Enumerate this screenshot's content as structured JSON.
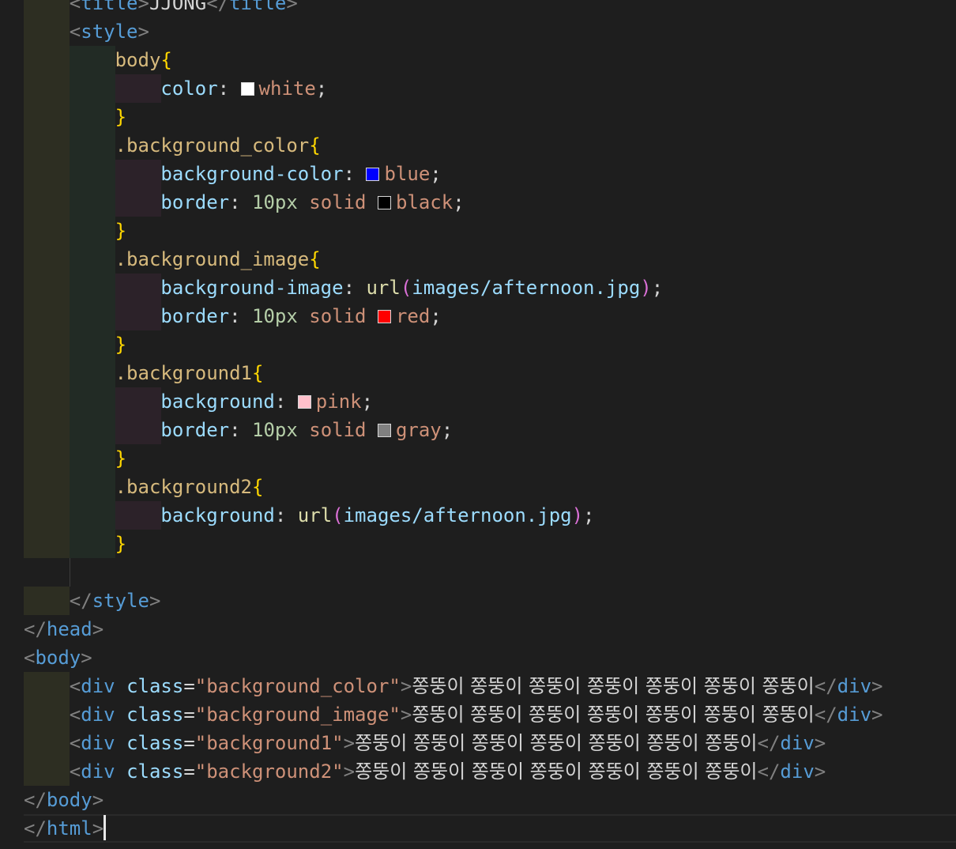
{
  "editor": {
    "lines": {
      "title_text": "JJONG",
      "title_tag": "title",
      "style_tag": "style",
      "head_tag": "head",
      "body_tag": "body",
      "html_tag": "html",
      "div_tag": "div",
      "class_attr": "class",
      "body_selector": "body",
      "sel_bg_color": ".background_color",
      "sel_bg_image": ".background_image",
      "sel_bg1": ".background1",
      "sel_bg2": ".background2",
      "prop_color": "color",
      "prop_bg_color": "background-color",
      "prop_bg_image": "background-image",
      "prop_border": "border",
      "prop_background": "background",
      "val_white": "white",
      "val_blue": "blue",
      "val_black": "black",
      "val_red": "red",
      "val_pink": "pink",
      "val_gray": "gray",
      "val_10px": "10px",
      "val_solid": "solid",
      "val_url_fn": "url",
      "val_url_path": "images/afternoon.jpg",
      "str_bg_color": "\"background_color\"",
      "str_bg_image": "\"background_image\"",
      "str_bg1": "\"background1\"",
      "str_bg2": "\"background2\"",
      "div_text": "쫑뚱이 쫑뚱이 쫑뚱이 쫑뚱이 쫑뚱이 쫑뚱이 쫑뚱이"
    },
    "swatches": {
      "white": "#ffffff",
      "blue": "#0000ff",
      "black": "#000000",
      "red": "#ff0000",
      "pink": "#ffc0cb",
      "gray": "#808080"
    }
  }
}
